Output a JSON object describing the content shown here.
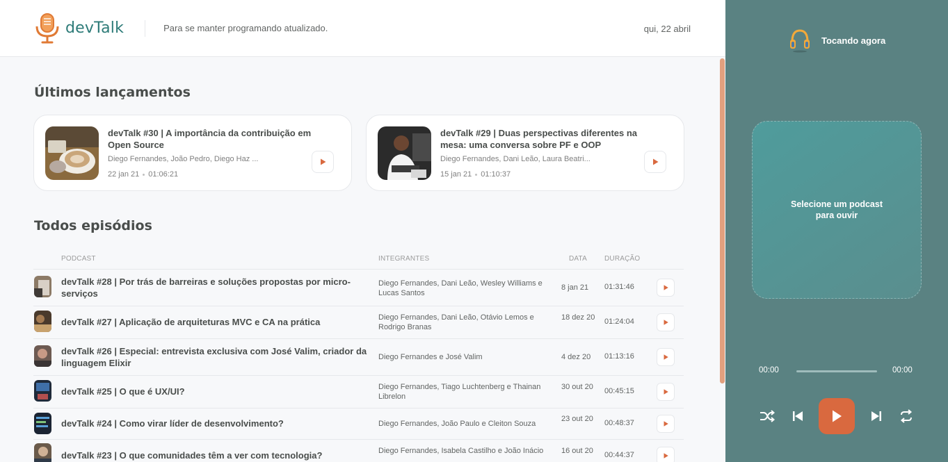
{
  "header": {
    "logo_text": "devTalk",
    "tagline": "Para se manter programando atualizado.",
    "date": "qui, 22 abril"
  },
  "latest": {
    "title": "Últimos lançamentos",
    "cards": [
      {
        "title": "devTalk #30 | A importância da contribuição em Open Source",
        "members": "Diego Fernandes, João Pedro, Diego Haz ...",
        "date": "22 jan 21",
        "duration": "01:06:21"
      },
      {
        "title": "devTalk #29 | Duas perspectivas diferentes na mesa: uma conversa sobre PF e OOP",
        "members": "Diego Fernandes, Dani Leão, Laura Beatri...",
        "date": "15 jan 21",
        "duration": "01:10:37"
      }
    ]
  },
  "all": {
    "title": "Todos episódios",
    "columns": {
      "podcast": "Podcast",
      "members": "Integrantes",
      "date": "Data",
      "duration": "Duração"
    },
    "rows": [
      {
        "title": "devTalk #28 | Por trás de barreiras e soluções propostas por micro-serviços",
        "members": "Diego Fernandes, Dani Leão, Wesley Williams e Lucas Santos",
        "date": "8 jan 21",
        "duration": "01:31:46"
      },
      {
        "title": "devTalk #27 | Aplicação de arquiteturas MVC e CA na prática",
        "members": "Diego Fernandes, Dani Leão, Otávio Lemos e Rodrigo Branas",
        "date": "18 dez 20",
        "duration": "01:24:04"
      },
      {
        "title": "devTalk #26 | Especial: entrevista exclusiva com José Valim, criador da linguagem Elixir",
        "members": "Diego Fernandes e José Valim",
        "date": "4 dez 20",
        "duration": "01:13:16"
      },
      {
        "title": "devTalk #25 | O que é UX/UI?",
        "members": "Diego Fernandes, Tiago Luchtenberg e Thainan Librelon",
        "date": "30 out 20",
        "duration": "00:45:15"
      },
      {
        "title": "devTalk #24 | Como virar líder de desenvolvimento?",
        "members": "Diego Fernandes, João Paulo e Cleiton Souza",
        "date": "23 out 20",
        "duration": "00:48:37"
      },
      {
        "title": "devTalk #23 | O que comunidades têm a ver com tecnologia?",
        "members": "Diego Fernandes, Isabela Castilho e João Inácio",
        "date": "16 out 20",
        "duration": "00:44:37"
      }
    ]
  },
  "player": {
    "now_playing": "Tocando agora",
    "empty_message": "Selecione um podcast para ouvir",
    "time_current": "00:00",
    "time_total": "00:00"
  },
  "colors": {
    "brand": "#2d7b78",
    "accent": "#d9693f",
    "player_bg": "#5a8282"
  },
  "icons": {
    "logo": "microphone-icon",
    "now_playing": "headphones-icon",
    "row_play": "play-icon",
    "shuffle": "shuffle-icon",
    "previous": "previous-icon",
    "play": "play-icon",
    "next": "next-icon",
    "repeat": "repeat-icon"
  }
}
